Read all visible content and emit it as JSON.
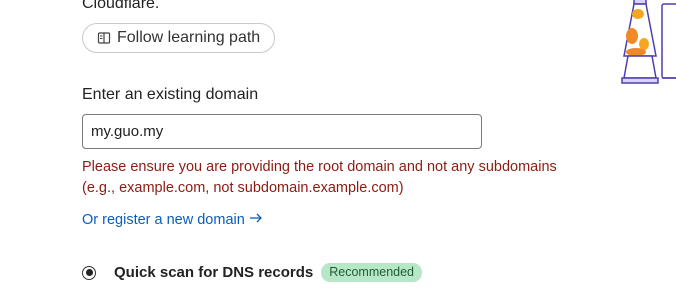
{
  "intro": {
    "tail_text": "Cloudflare."
  },
  "learning": {
    "button_label": "Follow learning path",
    "icon": "book-icon"
  },
  "domain": {
    "label": "Enter an existing domain",
    "value": "my.guo.my"
  },
  "error": {
    "line1": "Please ensure you are providing the root domain and not any subdomains",
    "line2": "(e.g., example.com, not subdomain.example.com)"
  },
  "register": {
    "label": "Or register a new domain",
    "icon": "arrow-right-icon"
  },
  "scan": {
    "label": "Quick scan for DNS records",
    "badge": "Recommended",
    "selected": true
  },
  "colors": {
    "error": "#8c1c13",
    "link": "#0b5dbd",
    "badge_bg": "#b8e7c8",
    "badge_text": "#1f5d34"
  }
}
